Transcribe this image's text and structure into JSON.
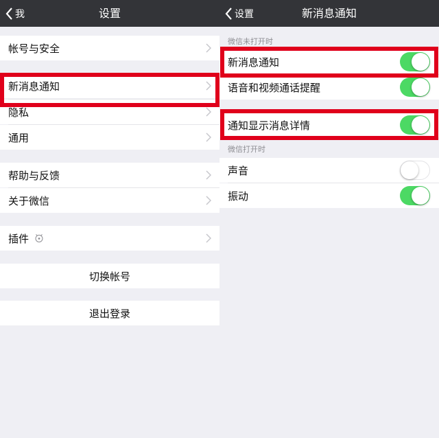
{
  "colors": {
    "nav_bg": "#333438",
    "toggle_on": "#4cd964",
    "highlight": "#e0001b",
    "bg": "#efeff4"
  },
  "left": {
    "nav": {
      "back_label": "我",
      "title": "设置"
    },
    "items": {
      "account_security": "帐号与安全",
      "new_message": "新消息通知",
      "privacy": "隐私",
      "general": "通用",
      "help": "帮助与反馈",
      "about": "关于微信",
      "plugins": "插件"
    },
    "switch_account": "切换帐号",
    "logout": "退出登录"
  },
  "right": {
    "nav": {
      "back_label": "设置",
      "title": "新消息通知"
    },
    "section1": "微信未打开时",
    "section2": "微信打开时",
    "rows": [
      {
        "label": "新消息通知",
        "on": true
      },
      {
        "label": "语音和视频通话提醒",
        "on": true
      },
      {
        "label": "通知显示消息详情",
        "on": true
      },
      {
        "label": "声音",
        "on": false
      },
      {
        "label": "振动",
        "on": true
      }
    ]
  }
}
